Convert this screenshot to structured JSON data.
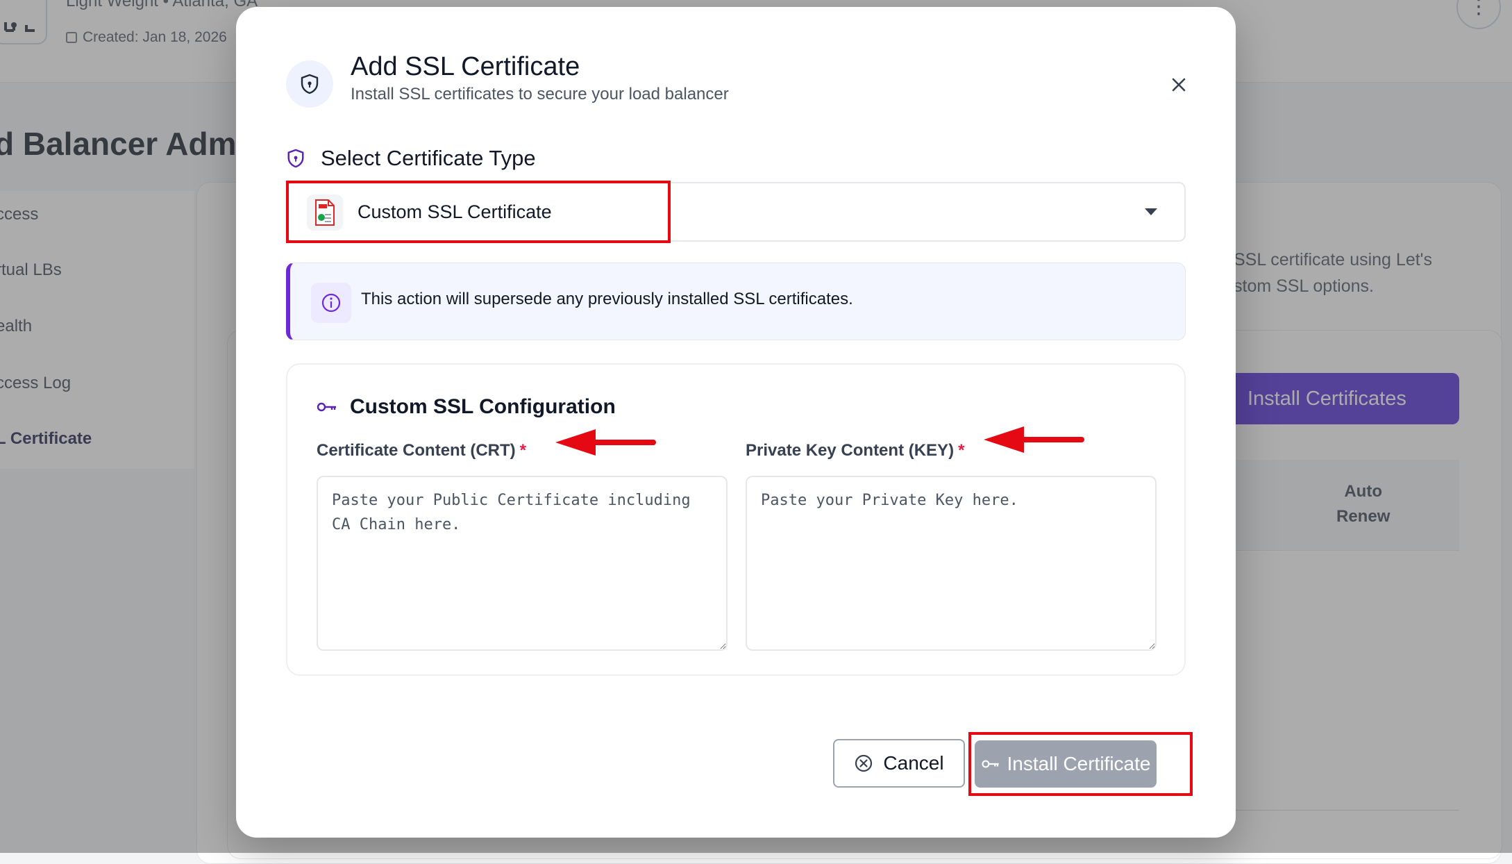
{
  "background": {
    "header": {
      "subtitle": "Light Weight • Atlanta, GA",
      "created": "Created: Jan 18, 2026"
    },
    "page_title": "d Balancer Adm",
    "sidebar": {
      "items": [
        {
          "label": "ccess"
        },
        {
          "label": "rtual LBs"
        },
        {
          "label": "ealth"
        },
        {
          "label": "ccess Log"
        },
        {
          "label": "L Certificate"
        }
      ]
    },
    "card": {
      "desc_line1": "SSL certificate using Let's",
      "desc_line2": "stom SSL options.",
      "install_button": "Install Certificates",
      "column_auto_renew_1": "Auto",
      "column_auto_renew_2": "Renew"
    }
  },
  "modal": {
    "title": "Add SSL Certificate",
    "subtitle": "Install SSL certificates to secure your load balancer",
    "section_label": "Select Certificate Type",
    "selected_type": "Custom SSL Certificate",
    "info_text": "This action will supersede any previously installed SSL certificates.",
    "config": {
      "title": "Custom SSL Configuration",
      "crt_label": "Certificate Content (CRT)",
      "crt_placeholder": "Paste your Public Certificate including CA Chain here.",
      "key_label": "Private Key Content (KEY)",
      "key_placeholder": "Paste your Private Key here.",
      "required_mark": "*"
    },
    "cancel_label": "Cancel",
    "install_label": "Install Certificate"
  },
  "colors": {
    "accent": "#4f2bd9",
    "annotation": "#e50914",
    "disabled_button": "#9ca3af",
    "info_border": "#6d28d9"
  }
}
